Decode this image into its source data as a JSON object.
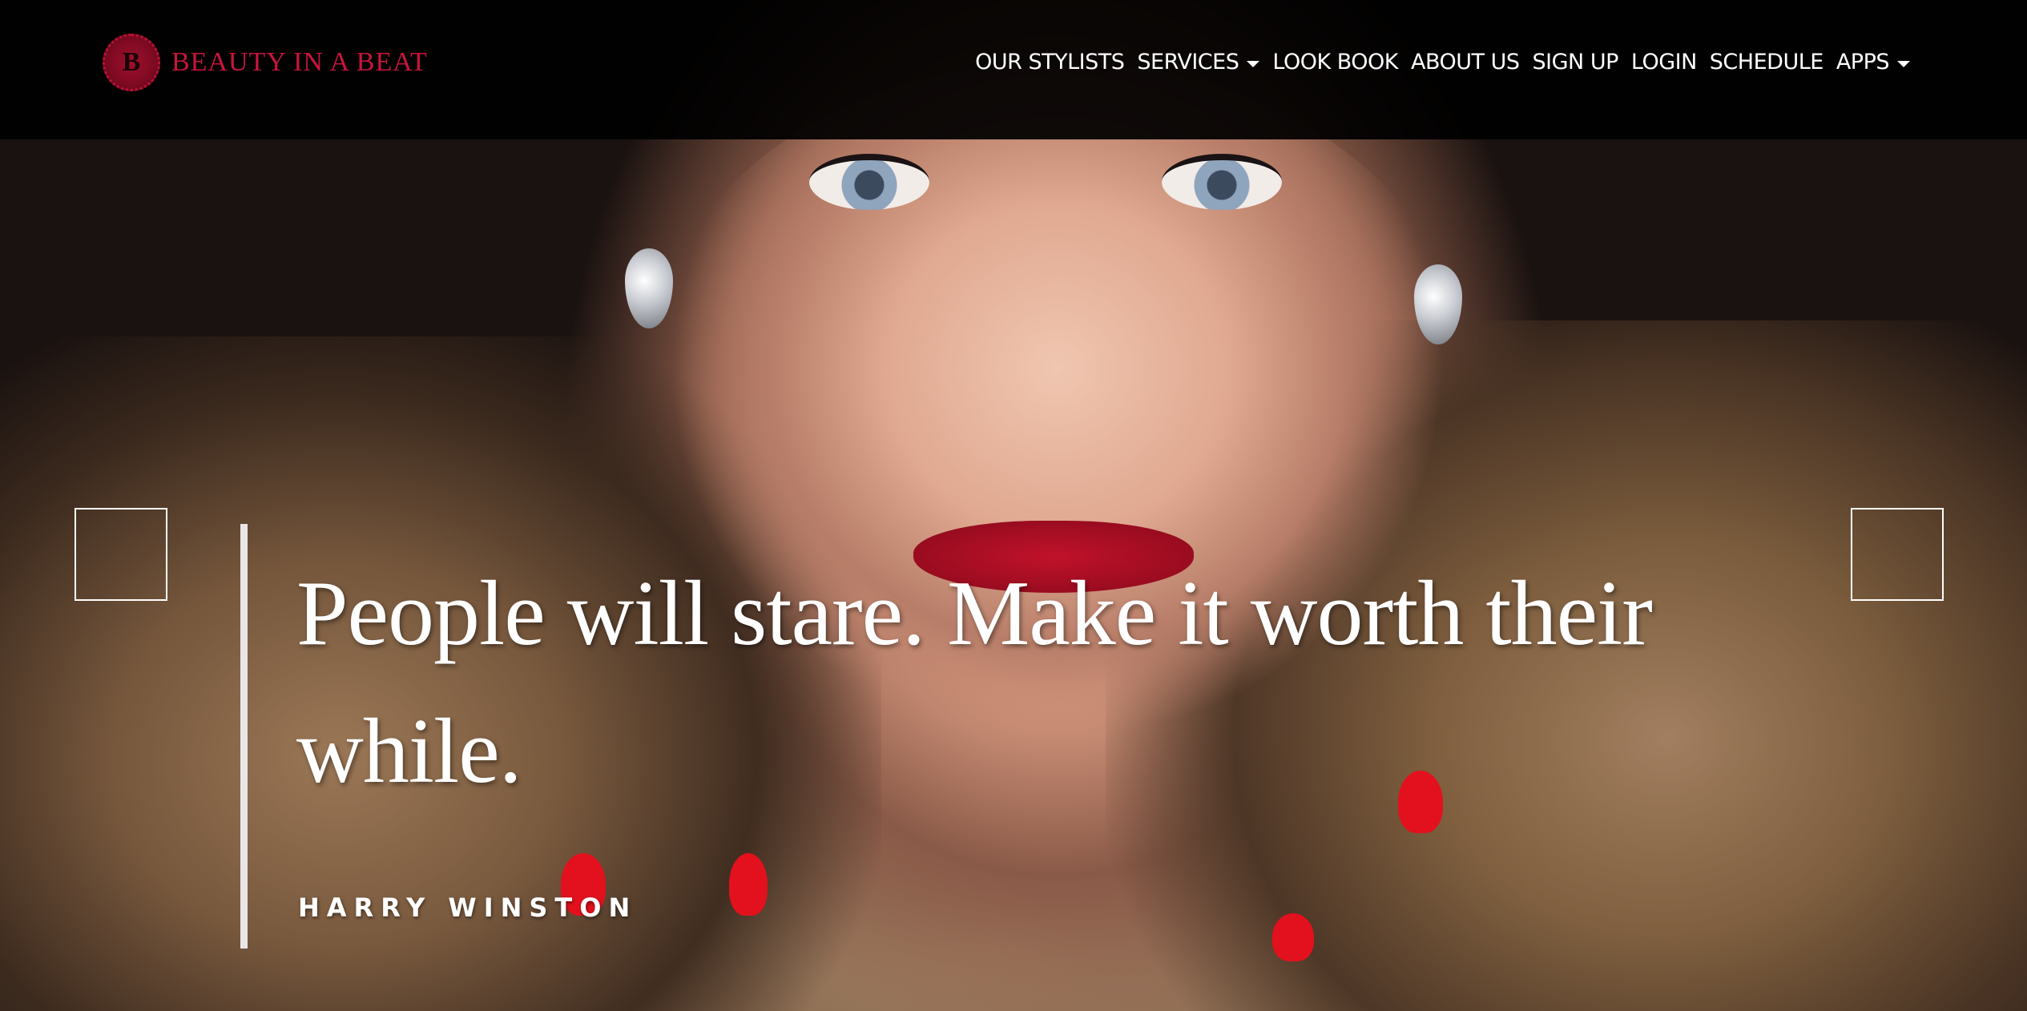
{
  "brand": {
    "logo_letter": "B",
    "name": "BEAUTY IN A BEAT",
    "color": "#c8153c"
  },
  "nav": {
    "items": [
      {
        "label": "OUR STYLISTS",
        "dropdown": false
      },
      {
        "label": "SERVICES",
        "dropdown": true
      },
      {
        "label": "LOOK BOOK",
        "dropdown": false
      },
      {
        "label": "ABOUT US",
        "dropdown": false
      },
      {
        "label": "SIGN UP",
        "dropdown": false
      },
      {
        "label": "LOGIN",
        "dropdown": false
      },
      {
        "label": "SCHEDULE",
        "dropdown": false
      },
      {
        "label": "APPS",
        "dropdown": true
      }
    ]
  },
  "hero": {
    "quote": "People will stare. Make it worth their while.",
    "author": "HARRY WINSTON",
    "prev_icon": "slider-prev-icon",
    "next_icon": "slider-next-icon"
  }
}
